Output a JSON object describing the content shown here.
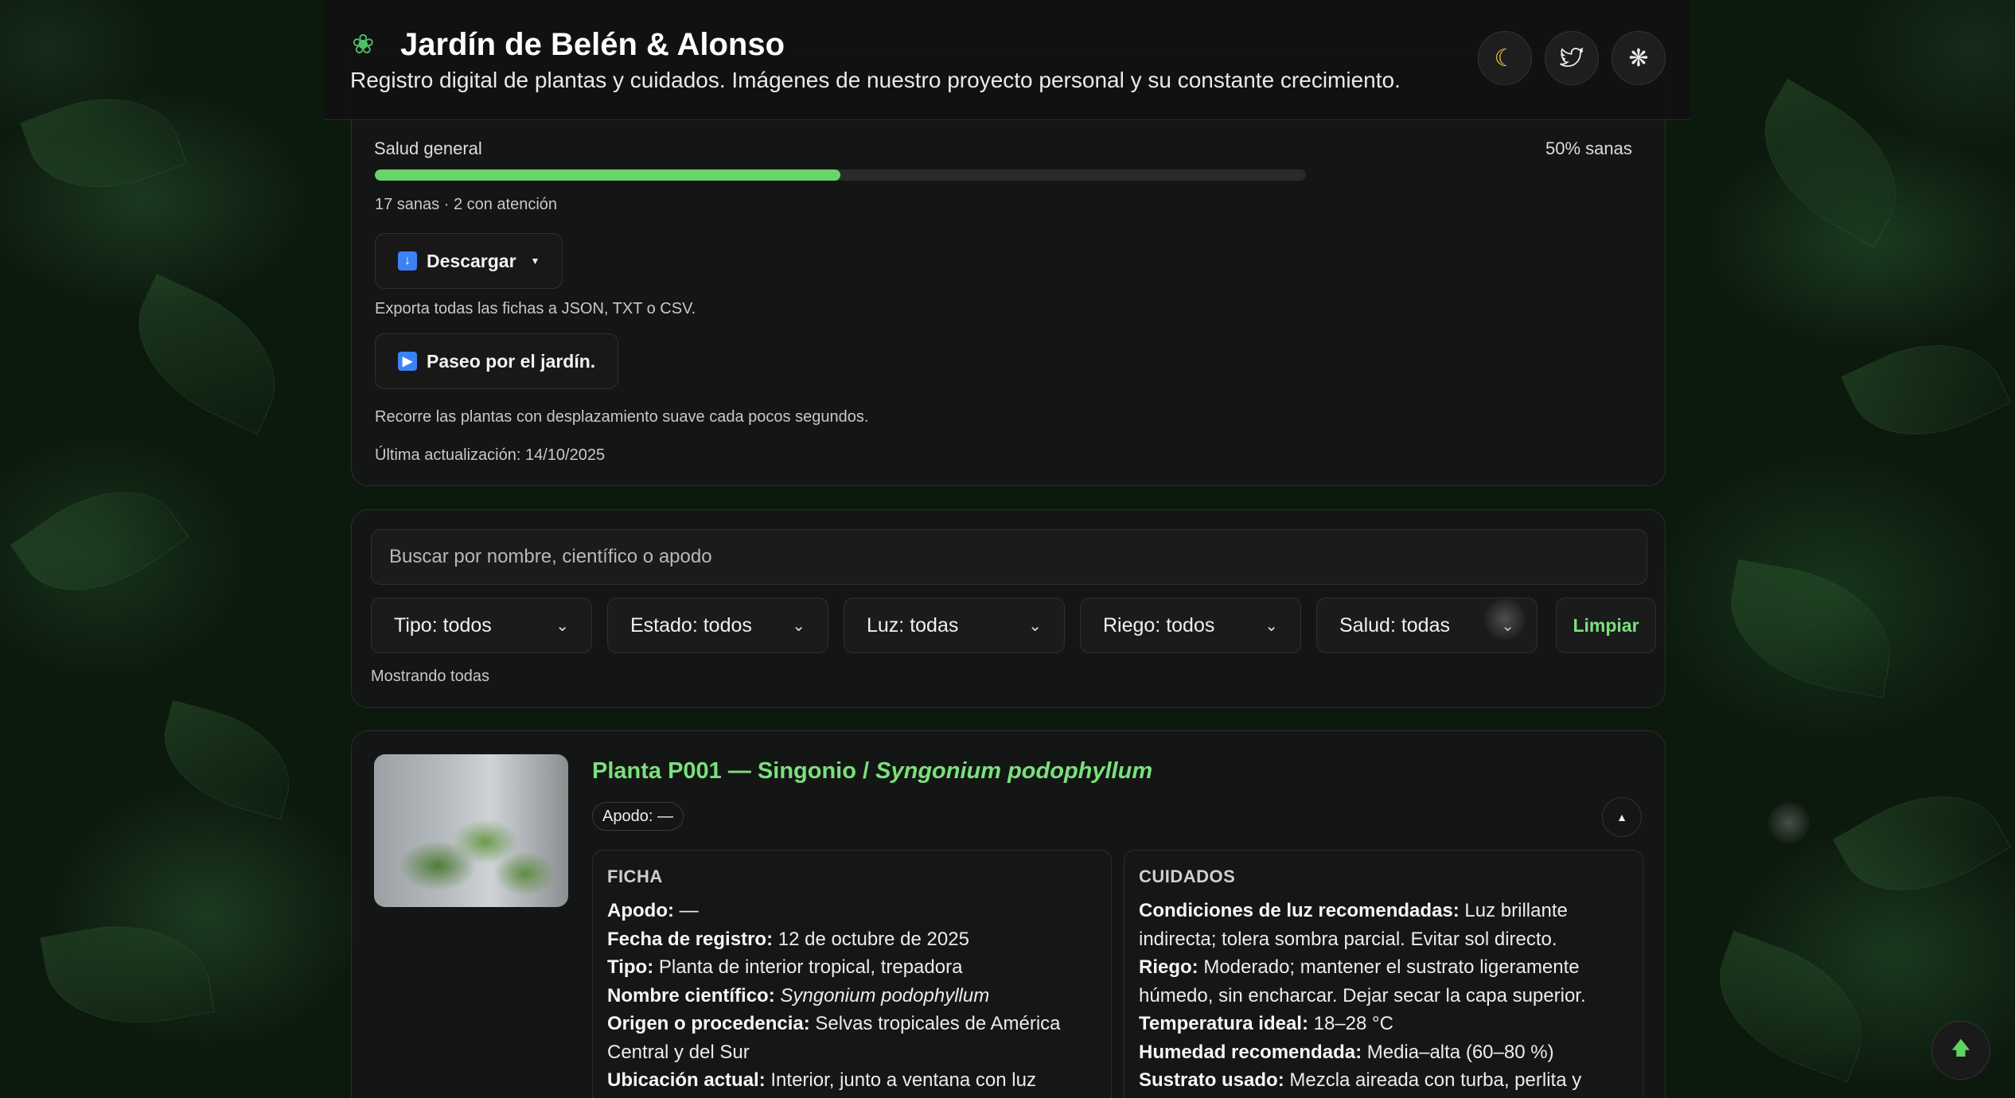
{
  "header": {
    "title": "Jardín de Belén & Alonso",
    "subtitle": "Registro digital de plantas y cuidados. Imágenes de nuestro proyecto personal y su constante crecimiento.",
    "icons": {
      "logo": "monstera-leaf-icon",
      "theme": "moon-icon",
      "twitter": "twitter-bird-icon",
      "other": "swirl-icon"
    }
  },
  "summary": {
    "health_label": "Salud general",
    "health_percent_text": "50% sanas",
    "health_fraction": 0.5,
    "health_detail": "17 sanas · 2 con atención",
    "download_label": "Descargar",
    "download_note": "Exporta todas las fichas a JSON, TXT o CSV.",
    "walk_label": "Paseo por el jardín.",
    "walk_note": "Recorre las plantas con desplazamiento suave cada pocos segundos.",
    "last_update": "Última actualización: 14/10/2025"
  },
  "filters": {
    "search_placeholder": "Buscar por nombre, científico o apodo",
    "selects": [
      "Tipo: todos",
      "Estado: todos",
      "Luz: todas",
      "Riego: todos",
      "Salud: todas"
    ],
    "clear_label": "Limpiar",
    "status": "Mostrando todas"
  },
  "plant": {
    "title_prefix": "Planta P001 — Singonio / ",
    "title_scientific": "Syngonium podophyllum",
    "nickname_chip": "Apodo: —",
    "ficha": {
      "heading": "FICHA",
      "rows": [
        {
          "label": "Apodo:",
          "value": " —"
        },
        {
          "label": "Fecha de registro:",
          "value": " 12 de octubre de 2025"
        },
        {
          "label": "Tipo:",
          "value": " Planta de interior tropical, trepadora"
        },
        {
          "label": "Nombre científico:",
          "value": " Syngonium podophyllum"
        },
        {
          "label": "Origen o procedencia:",
          "value": " Selvas tropicales de América Central y del Sur"
        },
        {
          "label": "Ubicación actual:",
          "value": " Interior, junto a ventana con luz"
        }
      ]
    },
    "cuidados": {
      "heading": "CUIDADOS",
      "rows": [
        {
          "label": "Condiciones de luz recomendadas:",
          "value": " Luz brillante indirecta; tolera sombra parcial. Evitar sol directo."
        },
        {
          "label": "Riego:",
          "value": " Moderado; mantener el sustrato ligeramente húmedo, sin encharcar. Dejar secar la capa superior."
        },
        {
          "label": "Temperatura ideal:",
          "value": " 18–28 °C"
        },
        {
          "label": "Humedad recomendada:",
          "value": " Media–alta (60–80 %)"
        },
        {
          "label": "Sustrato usado:",
          "value": " Mezcla aireada con turba, perlita y"
        }
      ]
    }
  },
  "colors": {
    "accent": "#7be07c",
    "progress": "#69d46a",
    "background": "#0c1a0e"
  }
}
